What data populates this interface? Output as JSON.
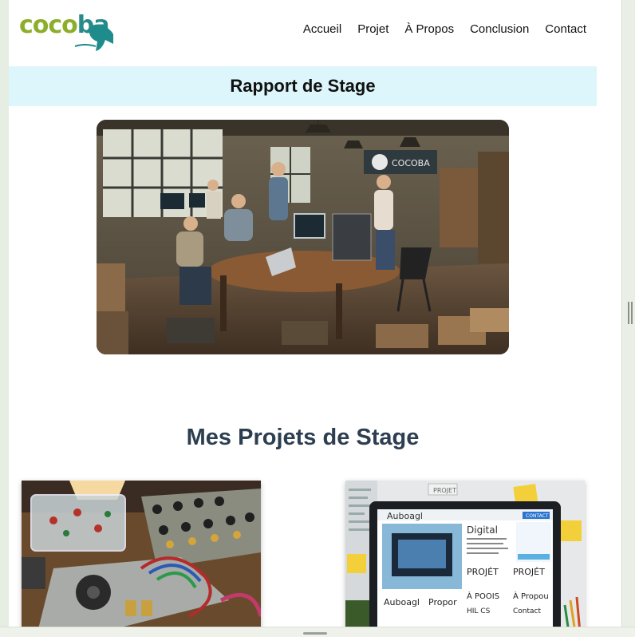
{
  "logo": {
    "part1": "coco",
    "part2": "ba"
  },
  "nav": {
    "items": [
      {
        "label": "Accueil"
      },
      {
        "label": "Projet"
      },
      {
        "label": "À Propos"
      },
      {
        "label": "Conclusion"
      },
      {
        "label": "Contact"
      }
    ]
  },
  "banner": {
    "title": "Rapport de Stage"
  },
  "hero": {
    "sign_text": "COCOBA"
  },
  "projects": {
    "title": "Mes Projets de Stage",
    "card2": {
      "screen_title": "Auboagl",
      "heading": "Digital",
      "col1": "PROJÉT",
      "col2": "PROJÉT",
      "row2a": "Auboagl",
      "row2b": "Propor",
      "row3a": "À POOIS",
      "row3b": "À Propou",
      "row4a": "HIL CS",
      "row4b": "Contact",
      "cta": "CONTACT",
      "wall": "PROJET"
    }
  }
}
